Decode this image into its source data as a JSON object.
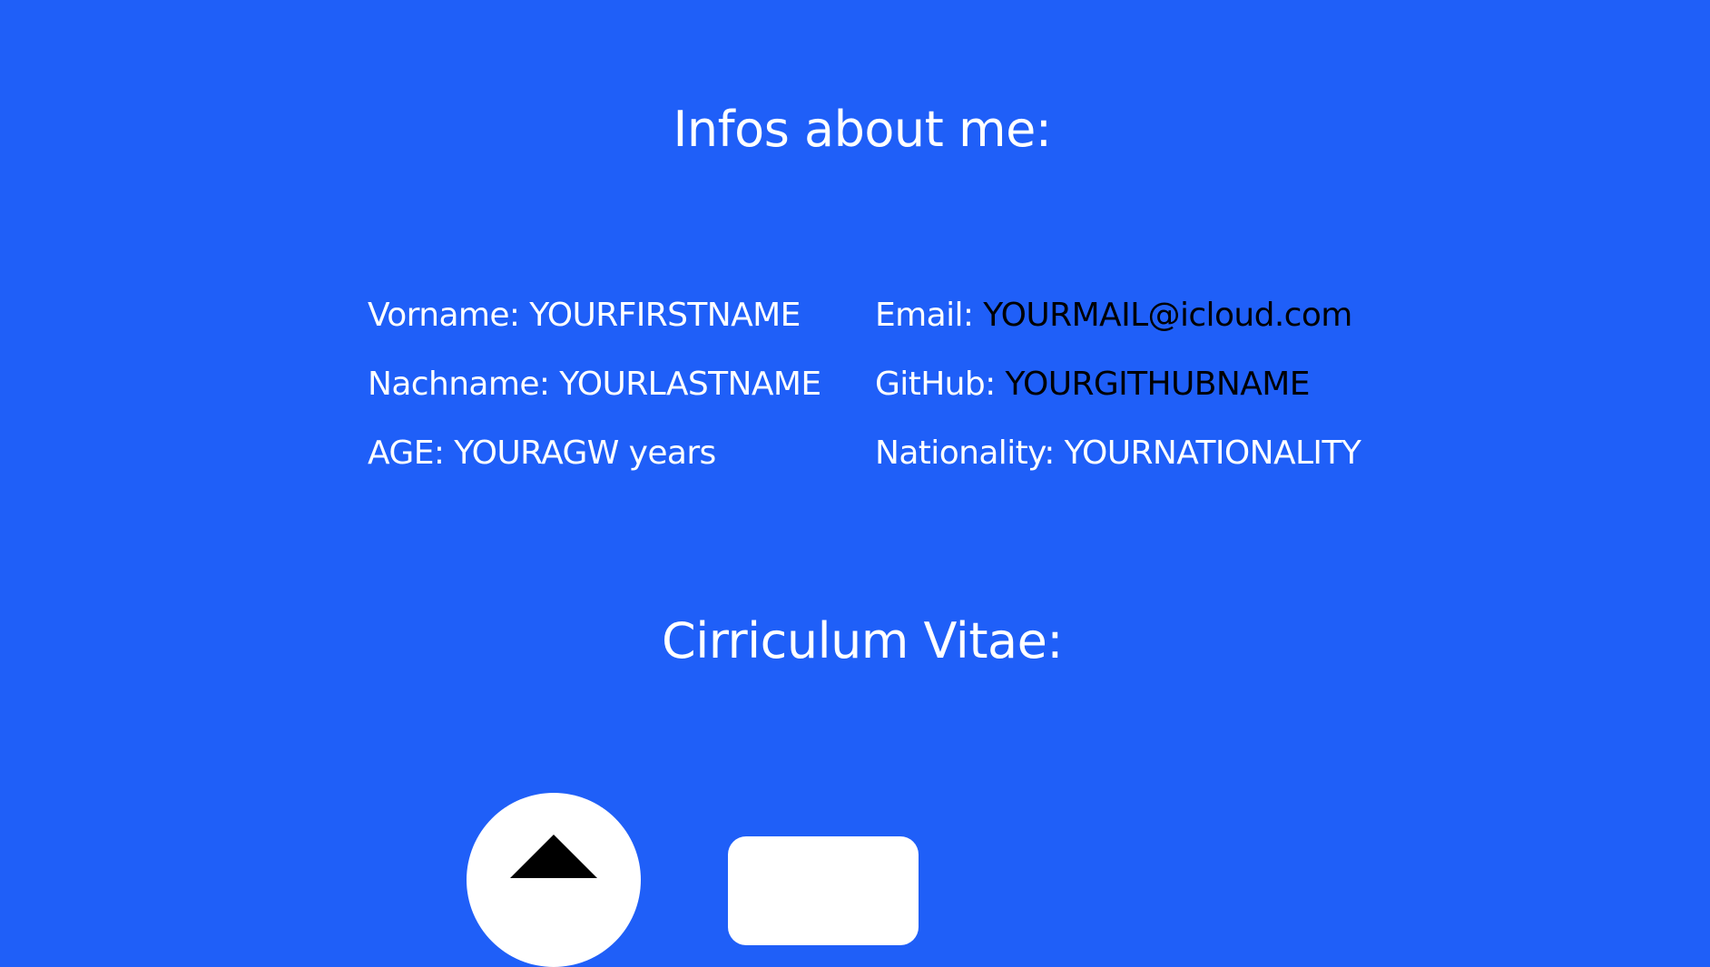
{
  "infos": {
    "heading": "Infos about me:",
    "left": [
      {
        "label": "Vorname: ",
        "value": "YOURFIRSTNAME"
      },
      {
        "label": "Nachname: ",
        "value": "YOURLASTNAME"
      },
      {
        "label": "AGE: ",
        "value": "YOURAGW years"
      }
    ],
    "right": [
      {
        "label": "Email: ",
        "value": "YOURMAIL@icloud.com"
      },
      {
        "label": "GitHub: ",
        "value": "YOURGITHUBNAME"
      },
      {
        "label": "Nationality: ",
        "value": "YOURNATIONALITY"
      }
    ]
  },
  "cv": {
    "heading": "Cirriculum Vitae:",
    "timeline_icon": "up-arrow-icon"
  },
  "colors": {
    "background": "#1f5ff8",
    "text": "#ffffff",
    "link_text": "#000000"
  }
}
